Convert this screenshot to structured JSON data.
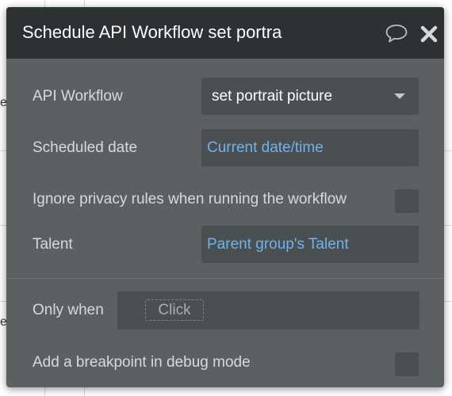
{
  "background": {
    "left_fragments": [
      "er",
      "er"
    ]
  },
  "dialog": {
    "title": "Schedule API Workflow set portra",
    "comment_icon": "speech-bubble-icon",
    "close_icon": "close-x-icon"
  },
  "fields": {
    "api_workflow": {
      "label": "API Workflow",
      "value": "set portrait picture"
    },
    "scheduled_date": {
      "label": "Scheduled date",
      "value": "Current date/time"
    },
    "ignore_privacy": {
      "label": "Ignore privacy rules when running the workflow",
      "checked": false
    },
    "talent": {
      "label": "Talent",
      "value": "Parent group's Talent"
    }
  },
  "condition": {
    "label": "Only when",
    "placeholder": "Click"
  },
  "breakpoint": {
    "label": "Add a breakpoint in debug mode",
    "checked": false
  },
  "colors": {
    "header_bg": "#2c3134",
    "panel_bg": "#5b6163",
    "field_bg": "#4a4f52",
    "link": "#6fb3ea",
    "label": "#d6dadc"
  }
}
